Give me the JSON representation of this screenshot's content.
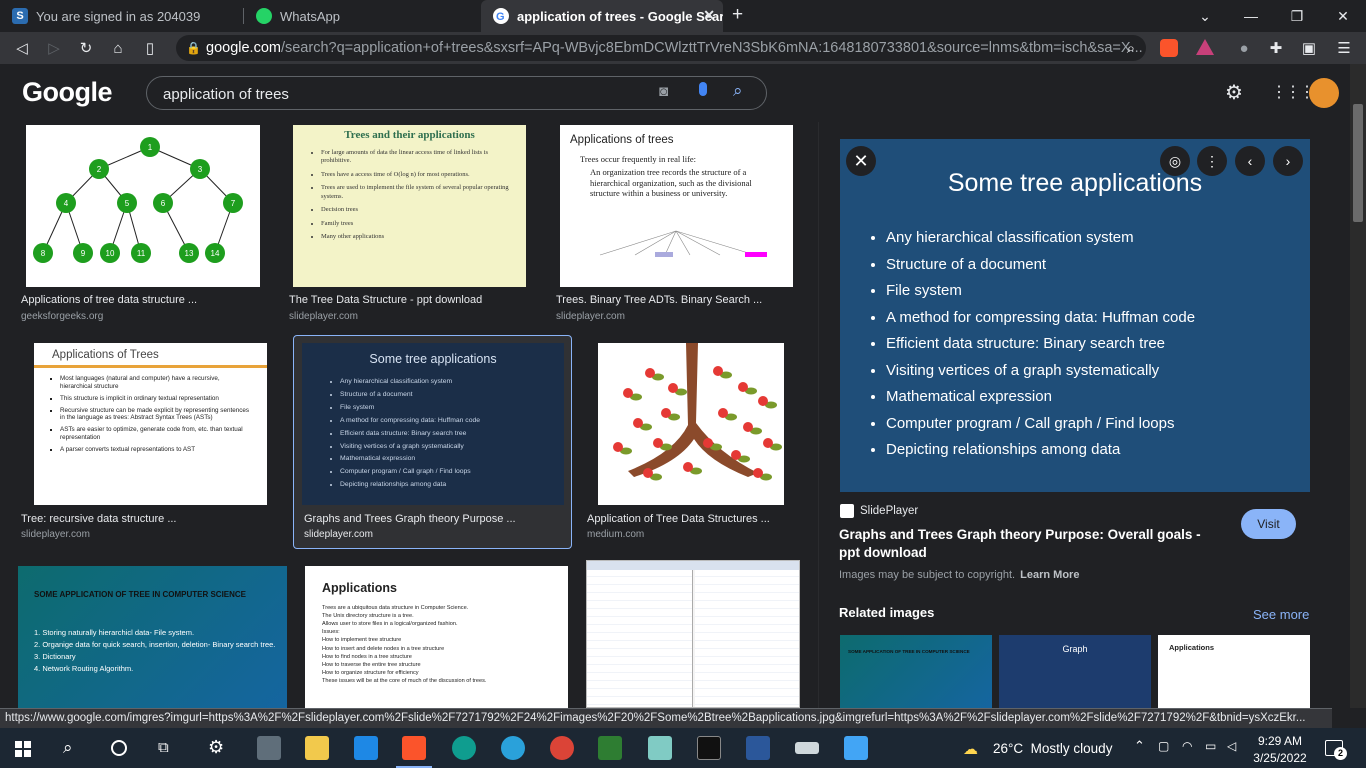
{
  "tabs": [
    {
      "title": "You are signed in as 204039",
      "icon": "S"
    },
    {
      "title": "WhatsApp"
    },
    {
      "title": "application of trees - Google Sear"
    }
  ],
  "address": {
    "host": "google.com",
    "path": "/search?q=application+of+trees&sxsrf=APq-WBvjc8EbmDCWlzttTrVreN3SbK6mNA:1648180733801&source=lnms&tbm=isch&sa=X..."
  },
  "google": {
    "logo": "Google",
    "query": "application of trees"
  },
  "results": [
    {
      "title": "Applications of tree data structure ...",
      "source": "geeksforgeeks.org"
    },
    {
      "title": "The Tree Data Structure - ppt download",
      "source": "slideplayer.com"
    },
    {
      "title": "Trees. Binary Tree ADTs. Binary Search ...",
      "source": "slideplayer.com"
    },
    {
      "title": "Tree: recursive data structure ...",
      "source": "slideplayer.com"
    },
    {
      "title": "Graphs and Trees Graph theory Purpose ...",
      "source": "slideplayer.com"
    },
    {
      "title": "Application of Tree Data Structures ...",
      "source": "medium.com"
    }
  ],
  "thumbs": {
    "t1_nodes": [
      "1",
      "2",
      "3",
      "4",
      "5",
      "6",
      "7",
      "8",
      "9",
      "10",
      "11",
      "13",
      "14"
    ],
    "t2_title": "Trees and their applications",
    "t2_items": [
      "For large amounts of data the linear access time of linked lists is prohibitive.",
      "Trees have a access time of O(log n) for most operations.",
      "Trees are used to implement the file system of several popular operating systems.",
      "Decision trees",
      "Family trees",
      "Many other applications"
    ],
    "t3_title": "Applications of trees",
    "t3_line1": "Trees occur frequently in real life:",
    "t3_bullet": "An organization tree records the structure of a hierarchical organization, such as the divisional structure within a business or university.",
    "t4_title": "Applications of Trees",
    "t4_items": [
      "Most languages (natural and computer) have a recursive, hierarchical structure",
      "This structure is implicit in ordinary textual representation",
      "Recursive structure can be made explicit by representing sentences in the language as trees: Abstract Syntax Trees (ASTs)",
      "ASTs are easier to optimize, generate code from, etc. than textual representation",
      "A parser converts textual representations to AST"
    ],
    "t7_title": "SOME APPLICATION OF TREE IN COMPUTER SCIENCE",
    "t7_items": [
      "1. Storing naturally hierarchicl data- File system.",
      "2. Organige data for quick search, insertion, deletion- Binary search tree.",
      "3. Dictionary",
      "4. Network Routing Algorithm."
    ],
    "t8_title": "Applications",
    "t8_lines": [
      "Trees are a ubiquitous data structure in Computer Science.",
      "The Unix directory structure is a tree.",
      "Allows user to store files in a logical/organized fashion.",
      "Issues:",
      "How to implement tree structure",
      "How to insert and delete nodes in a tree structure",
      "How to find nodes in a tree structure",
      "How to traverse the entire tree structure",
      "How to organize structure for efficiency",
      "These issues will be at the core of much of the discussion of trees."
    ]
  },
  "preview": {
    "title": "Some tree applications",
    "bullets": [
      "Any hierarchical classification system",
      "Structure of a document",
      "File system",
      "A method for compressing data:  Huffman code",
      "Efficient data structure:  Binary search tree",
      "Visiting vertices of a graph systematically",
      "Mathematical expression",
      "Computer program / Call graph / Find loops",
      "Depicting relationships among data"
    ]
  },
  "panel": {
    "site": "SlidePlayer",
    "title": "Graphs and Trees Graph theory Purpose: Overall goals - ppt download",
    "visit": "Visit",
    "copyright": "Images may be subject to copyright.",
    "learn_more": "Learn More",
    "related": "Related images",
    "see_more": "See more",
    "related_titles": [
      "SOME APPLICATION OF TREE IN COMPUTER SCIENCE",
      "Graph",
      "Applications"
    ]
  },
  "status_url": "https://www.google.com/imgres?imgurl=https%3A%2F%2Fslideplayer.com%2Fslide%2F7271792%2F24%2Fimages%2F20%2FSome%2Btree%2Bapplications.jpg&imgrefurl=https%3A%2F%2Fslideplayer.com%2Fslide%2F7271792%2F&tbnid=ysXczEkr...",
  "taskbar": {
    "weather": "26°C  Mostly cloudy",
    "time": "9:29 AM",
    "date": "3/25/2022",
    "notif": "2"
  }
}
